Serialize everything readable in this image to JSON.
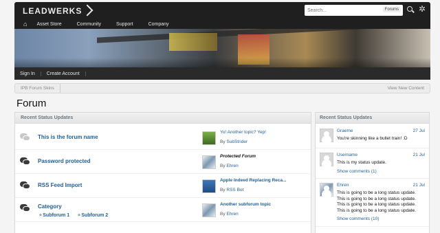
{
  "header": {
    "logo": "LEADWERKS",
    "search_placeholder": "Search...",
    "search_scope": "Forums",
    "nav": [
      "Asset Store",
      "Community",
      "Support",
      "Company"
    ]
  },
  "userbar": {
    "sign_in": "Sign In",
    "create_account": "Create Account"
  },
  "breadcrumb": {
    "item": "IPB Forum Skins",
    "view_new": "View New Content"
  },
  "page_title": "Forum",
  "forum": {
    "heading": "Recent Status Updates",
    "rows": [
      {
        "name": "This is the forum name",
        "read": true,
        "last_title": "Yo! Another topic? Yep!",
        "last_by": "SubStrider",
        "by_label": "By"
      },
      {
        "name": "Password protected",
        "read": false,
        "last_title": "Protected Forum",
        "last_by": "Ehren",
        "by_label": "By"
      },
      {
        "name": "RSS Feed Import",
        "read": false,
        "last_title": "Apple Indeed Replacing Reca...",
        "last_by": "RSS Bot",
        "by_label": "By"
      },
      {
        "name": "Category",
        "read": false,
        "subforums": [
          "Subforum 1",
          "Subforum 2"
        ],
        "last_title": "Another subforum topic",
        "last_by": "Ehren",
        "by_label": "By"
      }
    ]
  },
  "status": {
    "heading": "Recent Status Updates",
    "items": [
      {
        "name": "Graeme",
        "date": "27 Jul",
        "text": "You're skinning like a bullet train! :D"
      },
      {
        "name": "Username",
        "date": "21 Jul",
        "text": "This is my status update.",
        "comments": "Show comments (1)"
      },
      {
        "name": "Ehren",
        "date": "21 Jul",
        "text": "This is going to be a long status update. This is going to be a long status update. This is going to be a long status update. This is going to be a long status update.",
        "comments": "Show comments (10)"
      }
    ]
  }
}
